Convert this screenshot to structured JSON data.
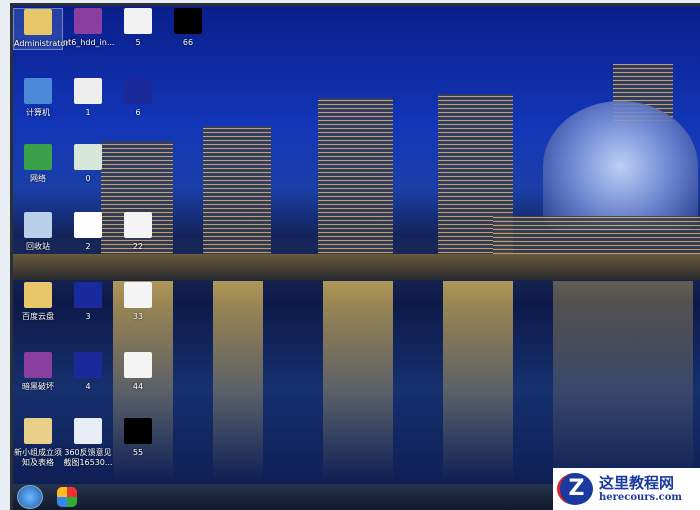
{
  "desktop": {
    "icons": [
      {
        "label": "Administrator",
        "icon": "user-folder-icon",
        "col": 0,
        "row": 0,
        "color": "#e8c76a",
        "selected": true
      },
      {
        "label": "nt6_hdd_in...",
        "icon": "winrar-archive-icon",
        "col": 1,
        "row": 0,
        "color": "#8a3fa0"
      },
      {
        "label": "5",
        "icon": "image-thumbnail-icon",
        "col": 2,
        "row": 0,
        "color": "#f2f2f2"
      },
      {
        "label": "66",
        "icon": "image-thumbnail-icon",
        "col": 3,
        "row": 0,
        "color": "#000000"
      },
      {
        "label": "计算机",
        "icon": "computer-icon",
        "col": 0,
        "row": 1,
        "color": "#4a8ad8"
      },
      {
        "label": "1",
        "icon": "image-thumbnail-icon",
        "col": 1,
        "row": 1,
        "color": "#eeeeee"
      },
      {
        "label": "6",
        "icon": "image-thumbnail-icon",
        "col": 2,
        "row": 1,
        "color": "#1a2a9a"
      },
      {
        "label": "网络",
        "icon": "network-icon",
        "col": 0,
        "row": 2,
        "color": "#3aa04a"
      },
      {
        "label": "0",
        "icon": "image-thumbnail-icon",
        "col": 1,
        "row": 2,
        "color": "#d8e8d8"
      },
      {
        "label": "回收站",
        "icon": "recycle-bin-icon",
        "col": 0,
        "row": 3,
        "color": "#b8d0e8"
      },
      {
        "label": "2",
        "icon": "image-thumbnail-icon",
        "col": 1,
        "row": 3,
        "color": "#ffffff"
      },
      {
        "label": "22",
        "icon": "image-thumbnail-icon",
        "col": 2,
        "row": 3,
        "color": "#f4f4f4"
      },
      {
        "label": "百度云盘",
        "icon": "folder-icon",
        "col": 0,
        "row": 4,
        "color": "#e8c76a"
      },
      {
        "label": "3",
        "icon": "image-thumbnail-icon",
        "col": 1,
        "row": 4,
        "color": "#1a2a9a"
      },
      {
        "label": "33",
        "icon": "image-thumbnail-icon",
        "col": 2,
        "row": 4,
        "color": "#f4f4f4"
      },
      {
        "label": "暗黑破坏",
        "icon": "winrar-archive-icon",
        "col": 0,
        "row": 5,
        "color": "#8a3fa0"
      },
      {
        "label": "4",
        "icon": "image-thumbnail-icon",
        "col": 1,
        "row": 5,
        "color": "#1a2a9a"
      },
      {
        "label": "44",
        "icon": "image-thumbnail-icon",
        "col": 2,
        "row": 5,
        "color": "#f4f4f4"
      },
      {
        "label": "新小组成立须知及表格",
        "icon": "folder-icon",
        "col": 0,
        "row": 6,
        "color": "#e8d08a"
      },
      {
        "label": "360反馈意见截图16530...",
        "icon": "image-thumbnail-icon",
        "col": 1,
        "row": 6,
        "color": "#e8eef8"
      },
      {
        "label": "55",
        "icon": "image-thumbnail-icon",
        "col": 2,
        "row": 6,
        "color": "#000000"
      }
    ]
  },
  "taskbar": {
    "start_icon": "windows-start-icon",
    "pinned": [
      {
        "icon": "360-app-icon"
      }
    ]
  },
  "watermark": {
    "title": "这里教程网",
    "url": "herecours.com"
  }
}
